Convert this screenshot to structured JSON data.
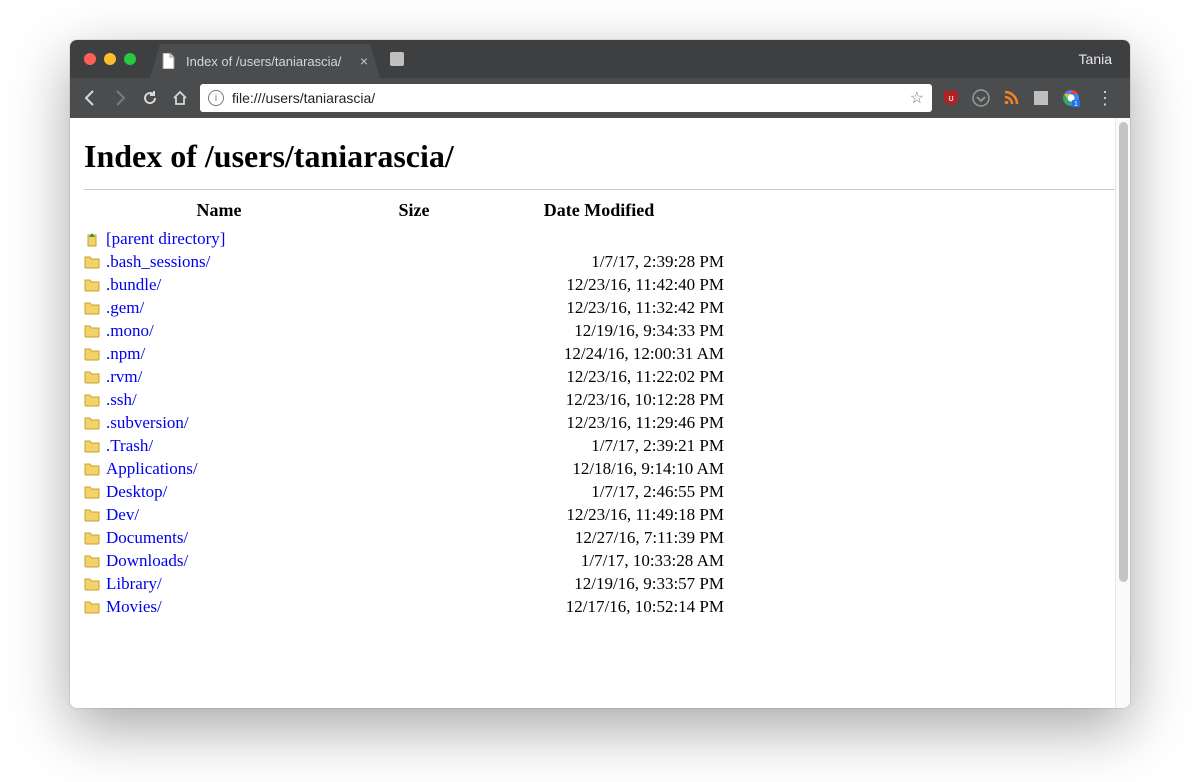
{
  "window": {
    "profile_name": "Tania"
  },
  "tab": {
    "title": "Index of /users/taniarascia/",
    "close_glyph": "×"
  },
  "toolbar": {
    "url": "file:///users/taniarascia/"
  },
  "page": {
    "heading": "Index of /users/taniarascia/",
    "columns": {
      "name": "Name",
      "size": "Size",
      "date": "Date Modified"
    },
    "parent_label": "[parent directory]",
    "entries": [
      {
        "name": ".bash_sessions/",
        "size": "",
        "date": "1/7/17, 2:39:28 PM"
      },
      {
        "name": ".bundle/",
        "size": "",
        "date": "12/23/16, 11:42:40 PM"
      },
      {
        "name": ".gem/",
        "size": "",
        "date": "12/23/16, 11:32:42 PM"
      },
      {
        "name": ".mono/",
        "size": "",
        "date": "12/19/16, 9:34:33 PM"
      },
      {
        "name": ".npm/",
        "size": "",
        "date": "12/24/16, 12:00:31 AM"
      },
      {
        "name": ".rvm/",
        "size": "",
        "date": "12/23/16, 11:22:02 PM"
      },
      {
        "name": ".ssh/",
        "size": "",
        "date": "12/23/16, 10:12:28 PM"
      },
      {
        "name": ".subversion/",
        "size": "",
        "date": "12/23/16, 11:29:46 PM"
      },
      {
        "name": ".Trash/",
        "size": "",
        "date": "1/7/17, 2:39:21 PM"
      },
      {
        "name": "Applications/",
        "size": "",
        "date": "12/18/16, 9:14:10 AM"
      },
      {
        "name": "Desktop/",
        "size": "",
        "date": "1/7/17, 2:46:55 PM"
      },
      {
        "name": "Dev/",
        "size": "",
        "date": "12/23/16, 11:49:18 PM"
      },
      {
        "name": "Documents/",
        "size": "",
        "date": "12/27/16, 7:11:39 PM"
      },
      {
        "name": "Downloads/",
        "size": "",
        "date": "1/7/17, 10:33:28 AM"
      },
      {
        "name": "Library/",
        "size": "",
        "date": "12/19/16, 9:33:57 PM"
      },
      {
        "name": "Movies/",
        "size": "",
        "date": "12/17/16, 10:52:14 PM"
      }
    ]
  }
}
